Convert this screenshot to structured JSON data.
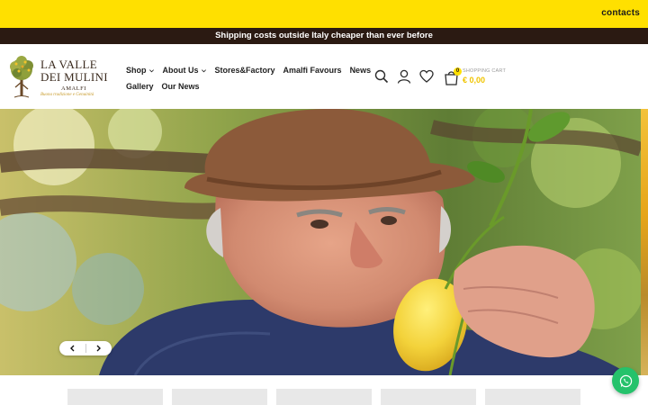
{
  "topbar": {
    "contacts_label": "contacts"
  },
  "notice": {
    "text": "Shipping costs outside Italy cheaper than ever before"
  },
  "logo": {
    "line1": "LA VALLE",
    "line2": "DEI MULINI",
    "city": "AMALFI",
    "tagline": "Buona tradizione e Genuinità"
  },
  "nav": {
    "row1": [
      {
        "label": "Shop",
        "has_dropdown": true
      },
      {
        "label": "About Us",
        "has_dropdown": true
      },
      {
        "label": "Stores&Factory",
        "has_dropdown": false
      },
      {
        "label": "Amalfi Favours",
        "has_dropdown": false
      },
      {
        "label": "News",
        "has_dropdown": false
      }
    ],
    "row2": [
      {
        "label": "Gallery",
        "has_dropdown": false
      },
      {
        "label": "Our News",
        "has_dropdown": false
      }
    ]
  },
  "icons": [
    "search-icon",
    "user-icon",
    "heart-icon"
  ],
  "cart": {
    "badge": "0",
    "label": "SHOPPING CART",
    "amount": "€ 0,00"
  },
  "hero": {
    "slide_description": "Elderly man in a brown hat smelling a lemon among lemon trees"
  },
  "colors": {
    "brand_yellow": "#ffe000",
    "dark_brown": "#2b1a12",
    "whatsapp_green": "#25c26b",
    "cart_amount": "#f0c400"
  }
}
